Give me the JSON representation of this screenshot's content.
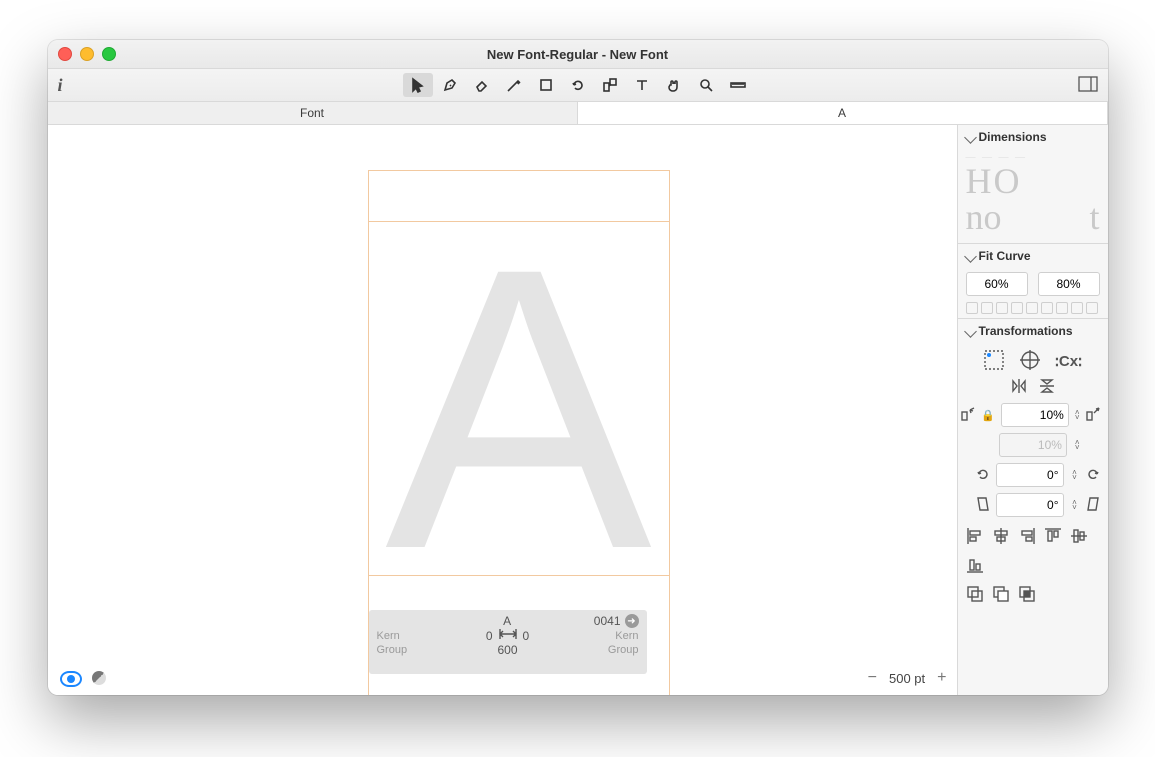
{
  "title": "New Font-Regular - New Font",
  "tabs": {
    "font": "Font",
    "glyph": "A"
  },
  "glyph": {
    "letter": "A",
    "name": "A",
    "unicode": "0041",
    "lsb": "0",
    "rsb": "0",
    "width": "600",
    "left_label1": "Kern",
    "left_label2": "Group",
    "right_label1": "Kern",
    "right_label2": "Group"
  },
  "zoom": "500 pt",
  "sidebar": {
    "dimensions": "Dimensions",
    "fit_curve": "Fit Curve",
    "fit_low": "60%",
    "fit_high": "80%",
    "transformations": "Transformations",
    "cx": "Cx",
    "scale1": "10%",
    "scale2": "10%",
    "rotate": "0°",
    "slant": "0°",
    "dim_big": "HO",
    "dim_no": "no",
    "dim_t": "t"
  },
  "icons": {
    "info": "i"
  }
}
